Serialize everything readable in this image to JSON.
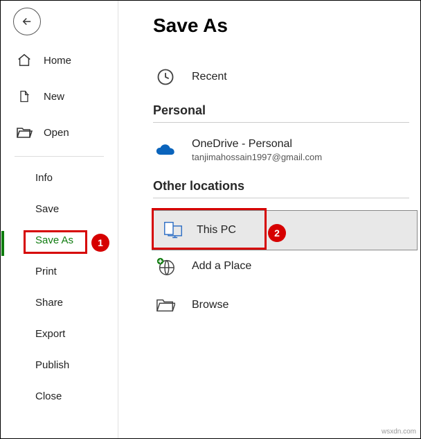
{
  "title": "Save As",
  "sidebar": {
    "home": "Home",
    "new": "New",
    "open": "Open",
    "info": "Info",
    "save": "Save",
    "saveAs": "Save As",
    "print": "Print",
    "share": "Share",
    "export": "Export",
    "publish": "Publish",
    "close": "Close"
  },
  "locations": {
    "recent": "Recent",
    "personalHead": "Personal",
    "onedrive": "OneDrive - Personal",
    "onedriveSub": "tanjimahossain1997@gmail.com",
    "otherHead": "Other locations",
    "thisPC": "This PC",
    "addPlace": "Add a Place",
    "browse": "Browse"
  },
  "annotations": {
    "n1": "1",
    "n2": "2"
  },
  "watermark": "wsxdn.com"
}
